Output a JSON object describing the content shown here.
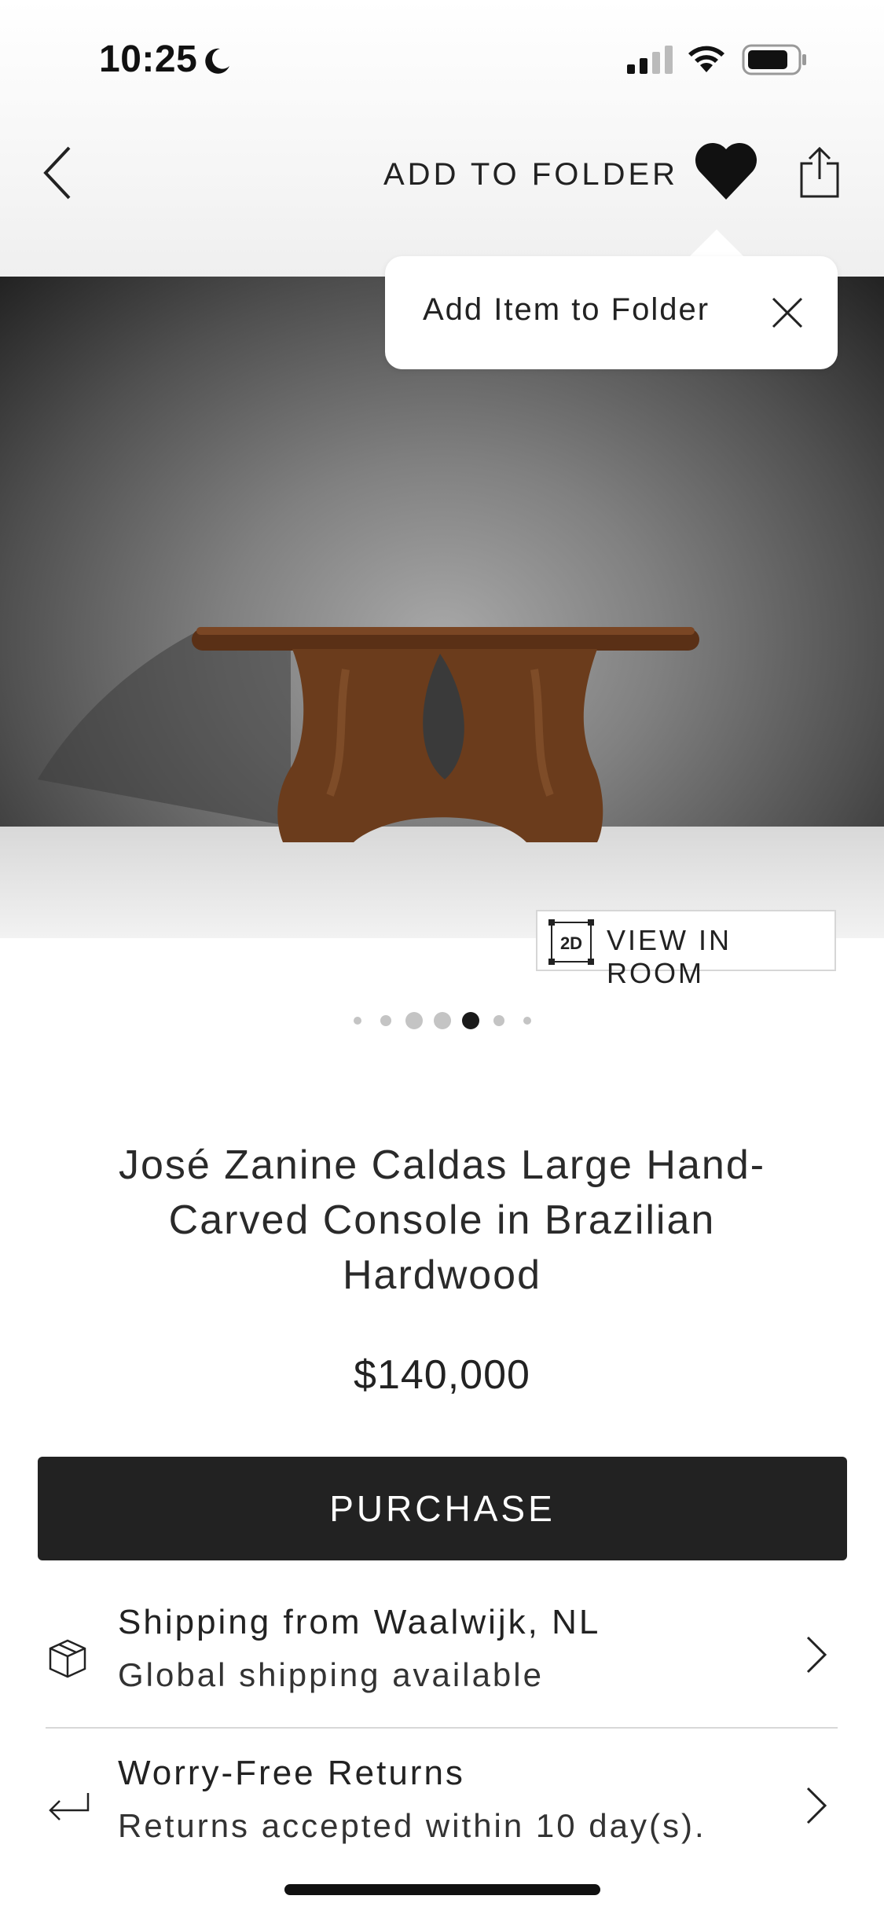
{
  "status_bar": {
    "time": "10:25"
  },
  "header": {
    "add_to_folder": "ADD TO FOLDER"
  },
  "tooltip": {
    "text": "Add Item to Folder"
  },
  "hero": {
    "view_in_room_badge": "2D",
    "view_in_room": "VIEW IN ROOM"
  },
  "carousel": {
    "dot_count": 7,
    "active_index": 4
  },
  "product": {
    "title": "José Zanine Caldas Large Hand-Carved Console in Brazilian Hardwood",
    "price": "$140,000"
  },
  "purchase": {
    "label": "PURCHASE"
  },
  "shipping": {
    "title": "Shipping from Waalwijk, NL",
    "subtitle": "Global shipping available"
  },
  "returns": {
    "title": "Worry-Free Returns",
    "subtitle": "Returns accepted within 10 day(s)."
  },
  "icons": {
    "back": "chevron-left-icon",
    "favorite": "heart-icon",
    "share": "share-icon",
    "close": "close-icon",
    "shipping": "box-icon",
    "returns": "return-arrow-icon"
  }
}
